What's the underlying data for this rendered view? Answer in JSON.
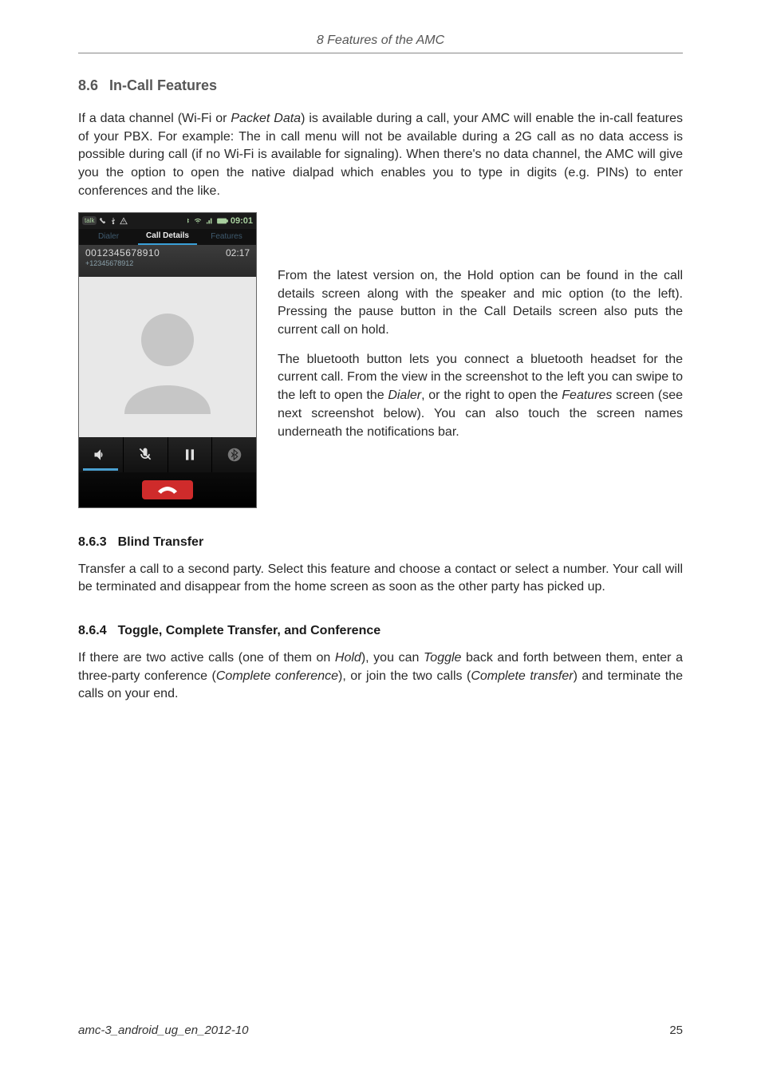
{
  "header": {
    "running_head": "8 Features of the AMC"
  },
  "section": {
    "number": "8.6",
    "title": "In-Call Features",
    "para1_a": "If a data channel (Wi-Fi or ",
    "para1_b": "Packet Data",
    "para1_c": ") is available during a call, your AMC will enable the in-call features of your PBX. For example: The in call menu will not be available during a 2G call as no data access is possible during call (if no Wi-Fi is available for signaling). When there's no data channel, the AMC will give you the option to open the native dialpad which enables you to type in digits (e.g. PINs) to enter conferences and the like.",
    "side_para_a": "From the latest version on, the Hold option can be found in the call details screen along with the speaker and mic option (to the left). Pressing the pause button in the Call Details screen also puts the current call on hold.",
    "side_para_b_a": "The bluetooth button lets you connect a bluetooth headset for the current call. From the view in the screenshot to the left you can swipe to the left to open the ",
    "side_para_b_b": "Dialer",
    "side_para_b_c": ", or the right to open the ",
    "side_para_b_d": "Features",
    "side_para_b_e": " screen (see next screenshot below). You can also touch the screen names underneath the notifications bar."
  },
  "sub1": {
    "number": "8.6.3",
    "title": "Blind Transfer",
    "para": "Transfer a call to a second party. Select this feature and choose a contact or select a number. Your call will be terminated and disappear from the home screen as soon as the other party has picked up."
  },
  "sub2": {
    "number": "8.6.4",
    "title": "Toggle, Complete Transfer, and Conference",
    "para_a": "If there are two active calls (one of them on ",
    "para_b": "Hold",
    "para_c": "), you can ",
    "para_d": "Toggle",
    "para_e": " back and forth between them, enter a three-party conference (",
    "para_f": "Complete conference",
    "para_g": "), or join the two calls (",
    "para_h": "Complete transfer",
    "para_i": ") and terminate the calls on your end."
  },
  "screenshot": {
    "status_time": "09:01",
    "tab_left": "Dialer",
    "tab_mid": "Call Details",
    "tab_right": "Features",
    "call_num1": "0012345678910",
    "call_num2": "+12345678912",
    "call_time": "02:17"
  },
  "footer": {
    "docid": "amc-3_android_ug_en_2012-10",
    "page": "25"
  }
}
